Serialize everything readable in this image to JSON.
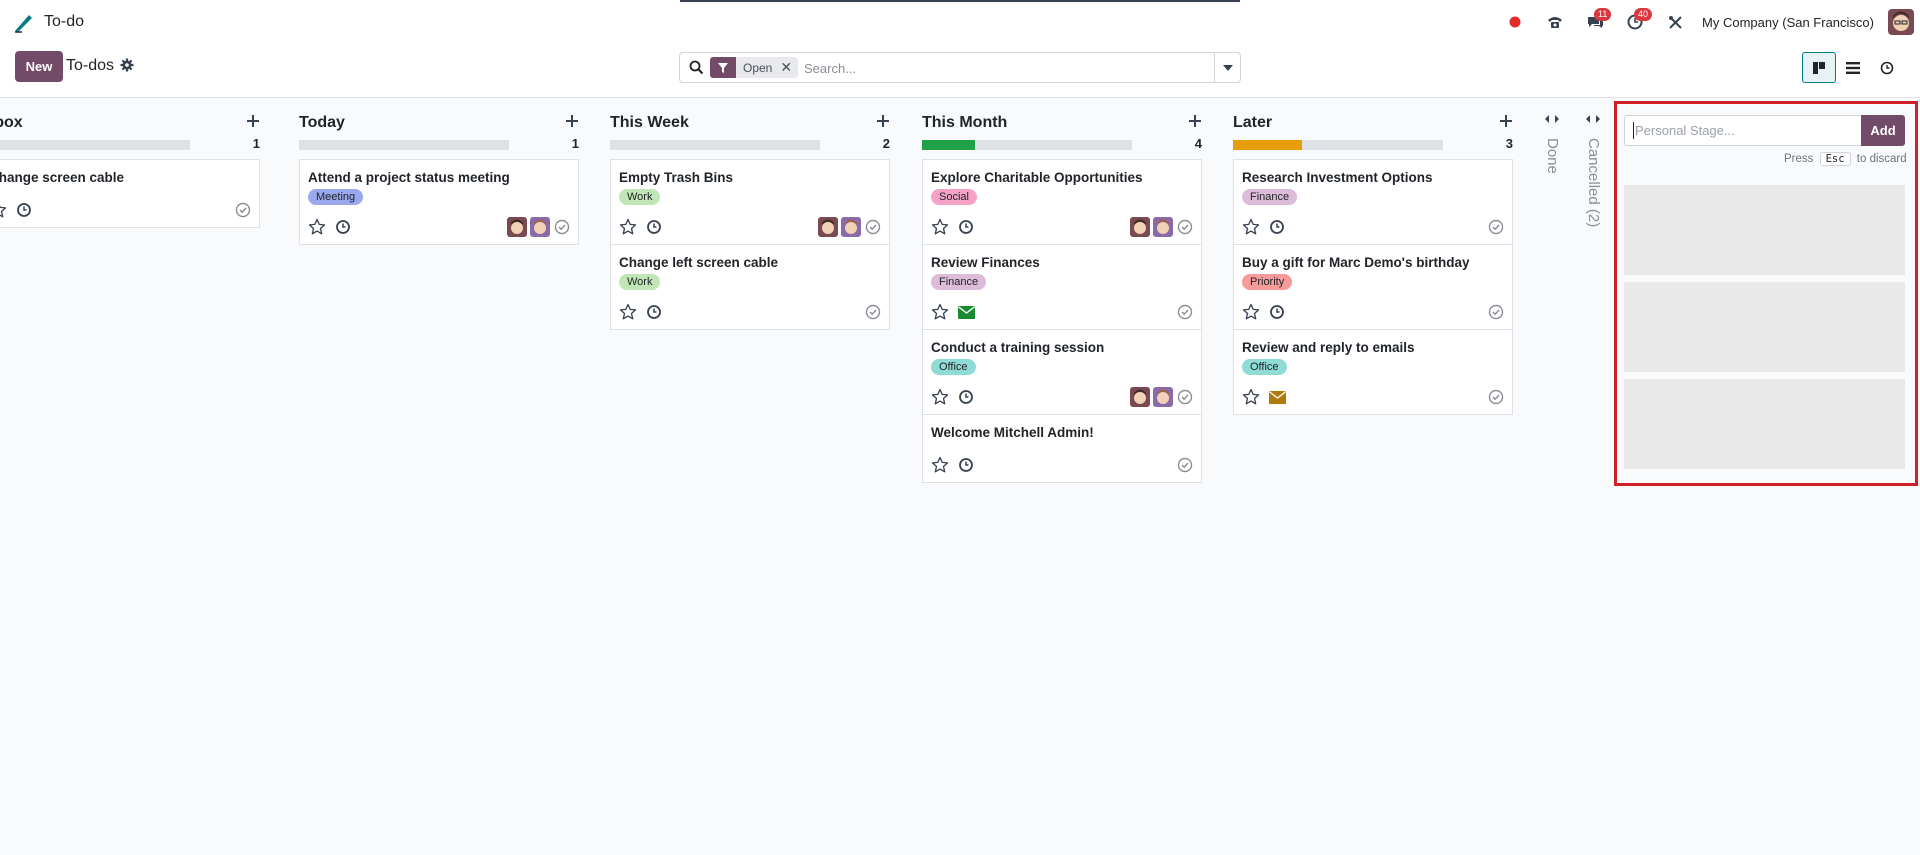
{
  "navbar": {
    "app_name": "To-do",
    "company": "My Company (San Francisco)",
    "messages_count": "11",
    "activities_count": "40"
  },
  "control": {
    "new_label": "New",
    "breadcrumb": "To-dos",
    "facet_value": "Open",
    "facet_remove": "✕",
    "search_placeholder": "Search..."
  },
  "columns": [
    {
      "title": "Inbox",
      "count": "1",
      "progress": 0,
      "cards": [
        {
          "title": "Change screen cable",
          "tag": "",
          "avatars": 0
        }
      ]
    },
    {
      "title": "Today",
      "count": "1",
      "progress": 0,
      "cards": [
        {
          "title": "Attend a project status meeting",
          "tag": "Meeting",
          "avatars": 2
        }
      ]
    },
    {
      "title": "This Week",
      "count": "2",
      "progress": 0,
      "cards": [
        {
          "title": "Empty Trash Bins",
          "tag": "Work",
          "avatars": 2
        },
        {
          "title": "Change left screen cable",
          "tag": "Work",
          "avatars": 0
        }
      ]
    },
    {
      "title": "This Month",
      "count": "4",
      "progress": 0.25,
      "progress_color": "#21a04a",
      "cards": [
        {
          "title": "Explore Charitable Opportunities",
          "tag": "Social",
          "avatars": 2
        },
        {
          "title": "Review Finances",
          "tag": "Finance",
          "avatars": 0,
          "activity": "mail-green"
        },
        {
          "title": "Conduct a training session",
          "tag": "Office",
          "avatars": 2
        },
        {
          "title": "Welcome Mitchell Admin!",
          "tag": "",
          "avatars": 0
        }
      ]
    },
    {
      "title": "Later",
      "count": "3",
      "progress": 0.33,
      "progress_color": "#e89d0b",
      "cards": [
        {
          "title": "Research Investment Options",
          "tag": "Finance",
          "avatars": 0
        },
        {
          "title": "Buy a gift for Marc Demo's birthday",
          "tag": "Priority",
          "avatars": 0
        },
        {
          "title": "Review and reply to emails",
          "tag": "Office",
          "avatars": 0,
          "activity": "mail-orange"
        }
      ]
    }
  ],
  "folded": [
    {
      "label": "Done"
    },
    {
      "label": "Cancelled (2)"
    }
  ],
  "quick_create": {
    "placeholder": "Personal Stage...",
    "add_label": "Add",
    "hint_press": "Press",
    "hint_key": "Esc",
    "hint_action": "to discard"
  },
  "tag_colors": {
    "Meeting": "#9aa8f0",
    "Work": "#bfe6b4",
    "Social": "#f4a3c6",
    "Finance": "#dcbcd9",
    "Office": "#8fdcd6",
    "Priority": "#f79a9a"
  },
  "icons": {
    "app": "pencil-icon",
    "tray": [
      "status-dot-icon",
      "phone-icon",
      "chat-icon",
      "clock-icon",
      "tools-icon"
    ],
    "views": [
      "kanban-view-icon",
      "list-view-icon",
      "activity-view-icon"
    ]
  }
}
